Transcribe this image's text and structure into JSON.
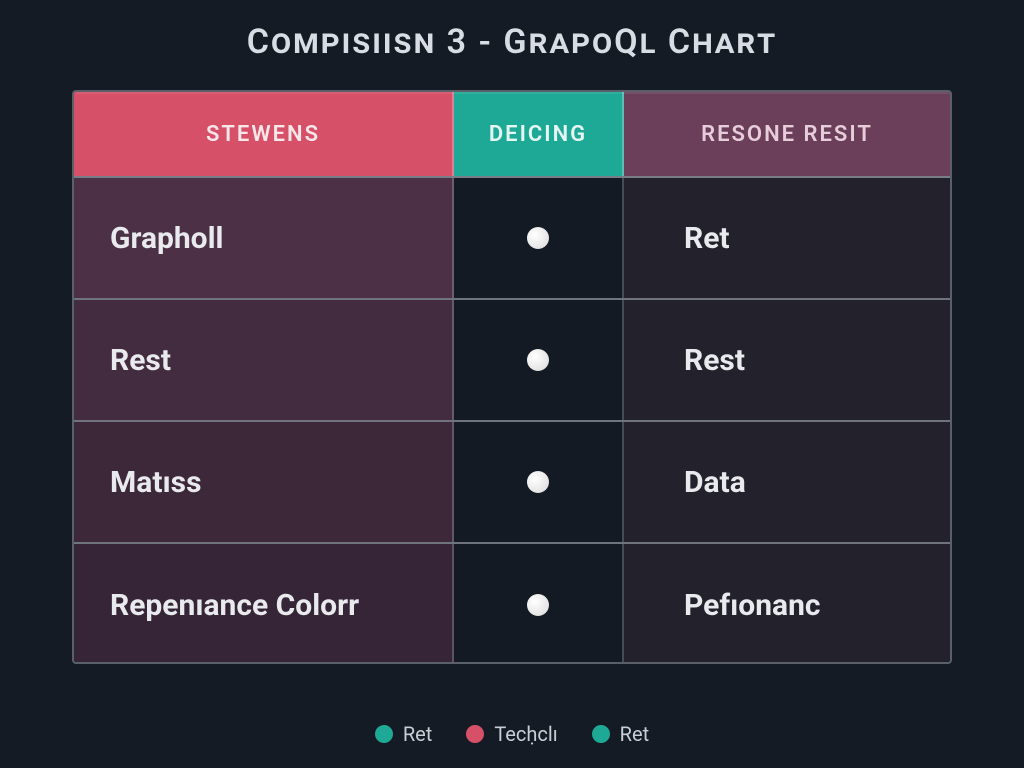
{
  "chart_data": {
    "type": "table",
    "title": "Compısıısn 3 - GrapoQl Chart",
    "columns": [
      "Stewens",
      "Deıcing",
      "Resone resıt"
    ],
    "rows": [
      {
        "label": "Grapholl",
        "mid": "dot",
        "right": "Ret"
      },
      {
        "label": "Rest",
        "mid": "dot",
        "right": "Rest"
      },
      {
        "label": "Matıss",
        "mid": "dot",
        "right": "Data"
      },
      {
        "label": "Repenıance Colorr",
        "mid": "dot",
        "right": "Pefıonanc"
      }
    ],
    "legend": [
      {
        "color": "teal",
        "label": "Ret"
      },
      {
        "color": "pink",
        "label": "Tecḥclı"
      },
      {
        "color": "teal2",
        "label": "Ret"
      }
    ]
  },
  "colors": {
    "pink": "#d65068",
    "teal": "#1ea996",
    "plum": "#6b3f5a",
    "bg": "#141b24"
  }
}
